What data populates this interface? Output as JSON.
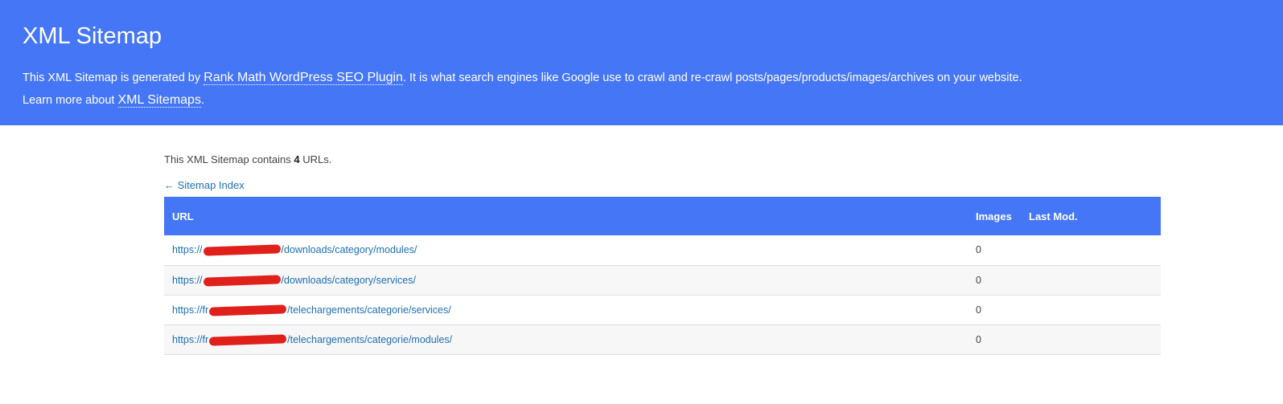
{
  "header": {
    "title": "XML Sitemap",
    "desc_line1_prefix": "This XML Sitemap is generated by ",
    "plugin_link": "Rank Math WordPress SEO Plugin",
    "desc_line1_suffix": ". It is what search engines like Google use to crawl and re-crawl posts/pages/products/images/archives on your website.",
    "desc_line2_prefix": "Learn more about ",
    "sitemaps_link": "XML Sitemaps",
    "desc_line2_suffix": "."
  },
  "summary": {
    "prefix": "This XML Sitemap contains ",
    "count": "4",
    "suffix": " URLs."
  },
  "back_link": "← Sitemap Index",
  "table": {
    "headers": {
      "url": "URL",
      "images": "Images",
      "last_mod": "Last Mod."
    },
    "rows": [
      {
        "url_start": "https://",
        "url_end": "/downloads/category/modules/",
        "images": "0",
        "last_mod": ""
      },
      {
        "url_start": "https://",
        "url_end": "/downloads/category/services/",
        "images": "0",
        "last_mod": ""
      },
      {
        "url_start": "https://fr",
        "url_end": "/telechargements/categorie/services/",
        "images": "0",
        "last_mod": ""
      },
      {
        "url_start": "https://fr",
        "url_end": "/telechargements/categorie/modules/",
        "images": "0",
        "last_mod": ""
      }
    ]
  },
  "colors": {
    "accent": "#4576f5",
    "link": "#1f6fb2",
    "redaction": "#e0201b"
  }
}
